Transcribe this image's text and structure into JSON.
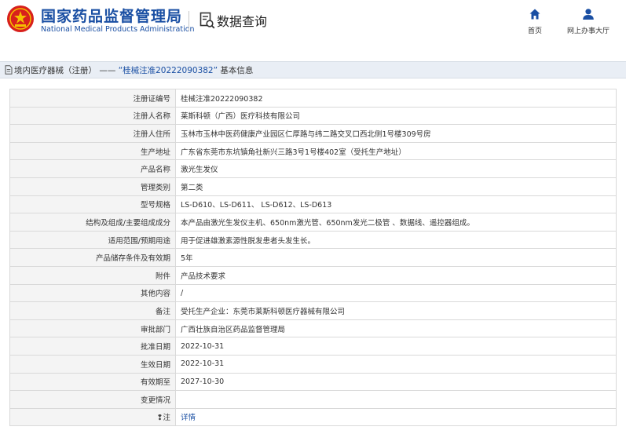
{
  "header": {
    "brand_cn": "国家药品监督管理局",
    "brand_en": "National Medical Products Administration",
    "query_title": "数据查询",
    "nav": {
      "home": "首页",
      "service_hall": "网上办事大厅"
    }
  },
  "breadcrumb": {
    "prefix": "境内医疗器械（注册）",
    "separator": "——",
    "highlight": "“桂械注准20222090382”",
    "suffix": "基本信息"
  },
  "details": {
    "rows": [
      {
        "label": "注册证编号",
        "value": "桂械注准20222090382"
      },
      {
        "label": "注册人名称",
        "value": "莱斯科顿（广西）医疗科技有限公司"
      },
      {
        "label": "注册人住所",
        "value": "玉林市玉林中医药健康产业园区仁厚路与纬二路交叉口西北侧1号楼309号房"
      },
      {
        "label": "生产地址",
        "value": "广东省东莞市东坑镇角社新兴三路3号1号楼402室（受托生产地址）"
      },
      {
        "label": "产品名称",
        "value": "激光生发仪"
      },
      {
        "label": "管理类别",
        "value": "第二类"
      },
      {
        "label": "型号规格",
        "value": "LS-D610、LS-D611、 LS-D612、LS-D613"
      },
      {
        "label": "结构及组成/主要组成成分",
        "value": "本产品由激光生发仪主机、650nm激光管、650nm发光二极管 、数据线、遥控器组成。"
      },
      {
        "label": "适用范围/预期用途",
        "value": "用于促进雄激素源性脱发患者头发生长。"
      },
      {
        "label": "产品储存条件及有效期",
        "value": "5年"
      },
      {
        "label": "附件",
        "value": "产品技术要求"
      },
      {
        "label": "其他内容",
        "value": "/"
      },
      {
        "label": "备注",
        "value": "受托生产企业：东莞市莱斯科顿医疗器械有限公司"
      },
      {
        "label": "审批部门",
        "value": "广西壮族自治区药品监督管理局"
      },
      {
        "label": "批准日期",
        "value": "2022-10-31"
      },
      {
        "label": "生效日期",
        "value": "2022-10-31"
      },
      {
        "label": "有效期至",
        "value": "2027-10-30"
      },
      {
        "label": "变更情况",
        "value": ""
      }
    ],
    "note_row": {
      "label": "注",
      "pin": "❢",
      "link": "详情"
    }
  },
  "colors": {
    "brand_blue": "#1a4fa3",
    "emblem_red": "#d8201c",
    "label_bg": "#f4f4f4",
    "crumb_bg": "#e9eef5",
    "border": "#d9d9d9"
  },
  "icons": [
    "national-emblem-icon",
    "search-document-icon",
    "home-icon",
    "user-icon",
    "document-icon"
  ]
}
